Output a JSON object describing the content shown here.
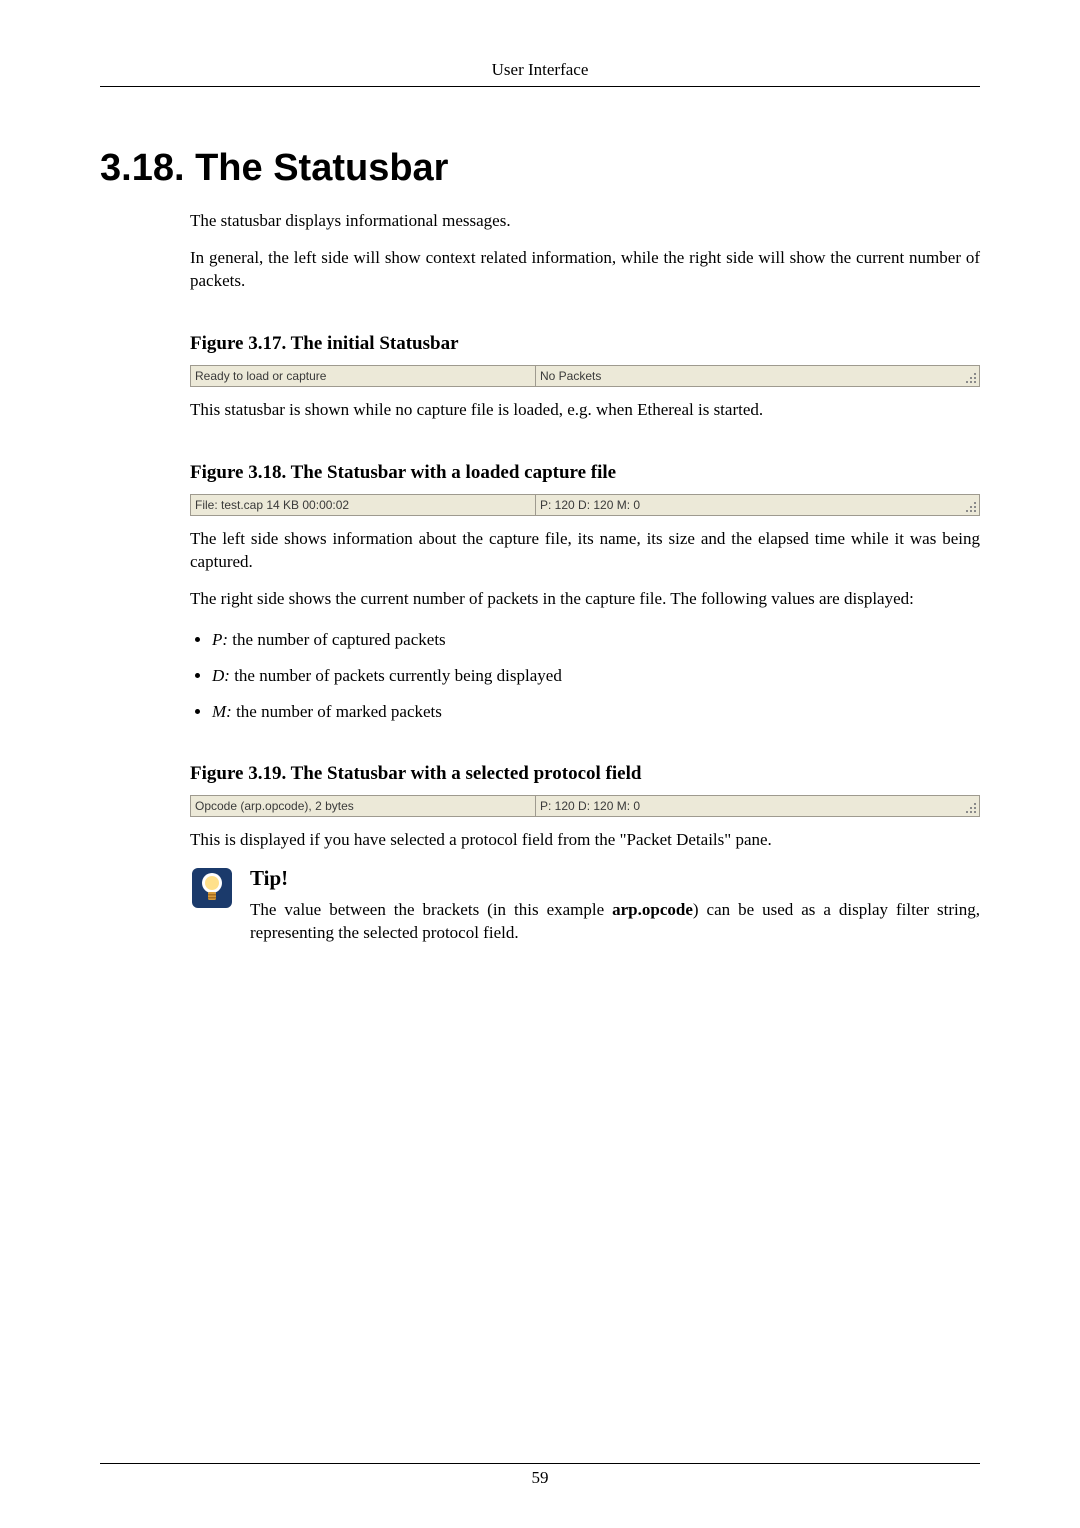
{
  "header_text": "User Interface",
  "section_title": "3.18. The Statusbar",
  "intro_p1": "The statusbar displays informational messages.",
  "intro_p2": "In general, the left side will show context related information, while the right side will show the current number of packets.",
  "fig17": {
    "caption": "Figure 3.17. The initial Statusbar",
    "left": "Ready to load or capture",
    "right": "No Packets",
    "after": "This statusbar is shown while no capture file is loaded, e.g. when Ethereal is started."
  },
  "fig18": {
    "caption": "Figure 3.18. The Statusbar with a loaded capture file",
    "left": "File: test.cap 14 KB 00:00:02",
    "right": "P: 120 D: 120 M: 0",
    "after_p1": "The left side shows information about the capture file, its name, its size and the elapsed time while it was being captured.",
    "after_p2": "The right side shows the current number of packets in the capture file. The following values are displayed:"
  },
  "bullets": {
    "p_label": "P:",
    "p_text": " the number of captured packets",
    "d_label": "D:",
    "d_text": " the number of packets currently being displayed",
    "m_label": "M:",
    "m_text": " the number of marked packets"
  },
  "fig19": {
    "caption": "Figure 3.19. The Statusbar with a selected protocol field",
    "left": "Opcode (arp.opcode), 2 bytes",
    "right": "P: 120 D: 120 M: 0",
    "after": "This is displayed if you have selected a protocol field from the \"Packet Details\" pane."
  },
  "tip": {
    "title": "Tip!",
    "text_before_bold": "The value between the brackets (in this example ",
    "bold": "arp.opcode",
    "text_after_bold": ") can be used as a display filter string, representing the selected protocol field."
  },
  "page_number": "59"
}
